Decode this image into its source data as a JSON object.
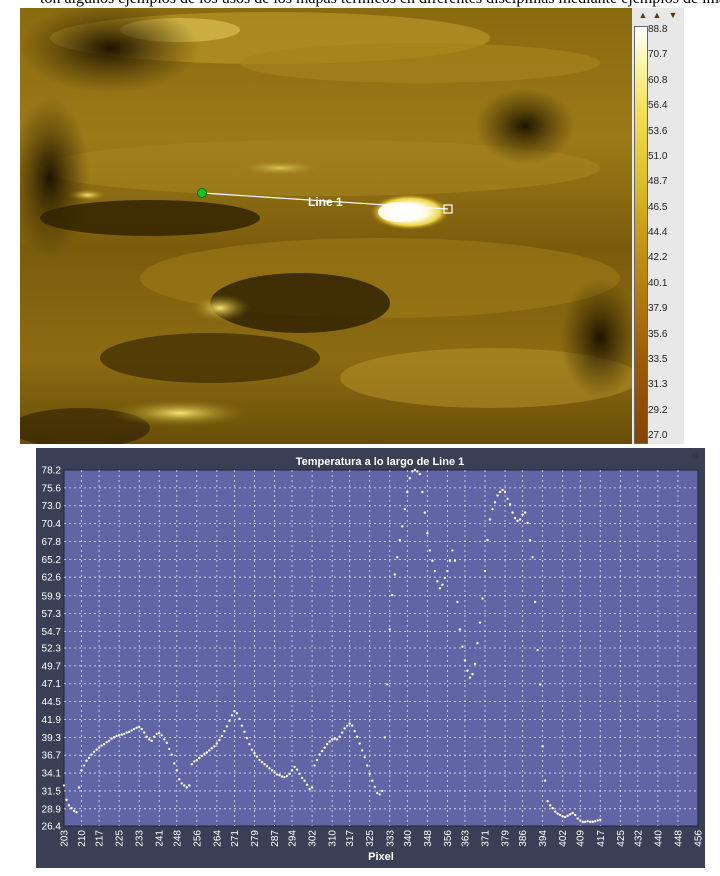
{
  "top_text": "ton algunos ejemplos de los usos de los mapas térmicos en diferentes disciplinas mediante ejemplos de imágenes",
  "thermal_image": {
    "line_label": "Line 1"
  },
  "color_scale": {
    "ticks": [
      "88.8",
      "70.7",
      "60.8",
      "56.4",
      "53.6",
      "51.0",
      "48.7",
      "46.5",
      "44.4",
      "42.2",
      "40.1",
      "37.9",
      "35.6",
      "33.5",
      "31.3",
      "29.2",
      "27.0"
    ],
    "colors": {
      "hot": "#ffffff",
      "mid": "#c89a18",
      "cold": "#844404"
    }
  },
  "collapse_icon_text": "«",
  "chart_data": {
    "type": "scatter",
    "title": "Temperatura a lo largo de Line 1",
    "xlabel": "Pixel",
    "ylabel": "",
    "xlim": [
      203,
      456
    ],
    "ylim": [
      26.4,
      78.2
    ],
    "grid": true,
    "xticks": [
      203,
      210,
      217,
      225,
      233,
      241,
      248,
      256,
      264,
      271,
      279,
      287,
      294,
      302,
      310,
      317,
      325,
      333,
      340,
      348,
      356,
      363,
      371,
      379,
      386,
      394,
      402,
      409,
      417,
      425,
      432,
      440,
      448,
      456
    ],
    "yticks": [
      26.4,
      28.9,
      31.5,
      34.1,
      36.7,
      39.3,
      41.9,
      44.5,
      47.1,
      49.7,
      52.3,
      54.7,
      57.3,
      59.9,
      62.6,
      65.2,
      67.8,
      70.4,
      73.0,
      75.6,
      78.2
    ],
    "points": [
      [
        203,
        32.3
      ],
      [
        204,
        30.2
      ],
      [
        205,
        29.4
      ],
      [
        206,
        29.0
      ],
      [
        207,
        28.6
      ],
      [
        208,
        28.4
      ],
      [
        209,
        32.0
      ],
      [
        210,
        34.5
      ],
      [
        211,
        35.2
      ],
      [
        212,
        35.9
      ],
      [
        213,
        36.3
      ],
      [
        214,
        36.8
      ],
      [
        215,
        37.2
      ],
      [
        216,
        37.5
      ],
      [
        217,
        37.8
      ],
      [
        218,
        38.1
      ],
      [
        219,
        38.3
      ],
      [
        220,
        38.6
      ],
      [
        221,
        38.8
      ],
      [
        222,
        39.1
      ],
      [
        223,
        39.3
      ],
      [
        224,
        39.5
      ],
      [
        225,
        39.6
      ],
      [
        226,
        39.7
      ],
      [
        227,
        39.8
      ],
      [
        228,
        40.0
      ],
      [
        229,
        40.1
      ],
      [
        230,
        40.3
      ],
      [
        231,
        40.5
      ],
      [
        232,
        40.7
      ],
      [
        233,
        40.8
      ],
      [
        234,
        40.5
      ],
      [
        235,
        40.0
      ],
      [
        236,
        39.4
      ],
      [
        237,
        39.0
      ],
      [
        238,
        38.8
      ],
      [
        239,
        39.4
      ],
      [
        240,
        39.8
      ],
      [
        241,
        39.9
      ],
      [
        242,
        39.6
      ],
      [
        243,
        39.0
      ],
      [
        244,
        38.5
      ],
      [
        245,
        37.6
      ],
      [
        246,
        36.8
      ],
      [
        247,
        35.5
      ],
      [
        248,
        34.5
      ],
      [
        249,
        33.2
      ],
      [
        250,
        32.6
      ],
      [
        251,
        32.3
      ],
      [
        252,
        32.0
      ],
      [
        253,
        32.3
      ],
      [
        254,
        35.4
      ],
      [
        255,
        35.8
      ],
      [
        256,
        36.0
      ],
      [
        257,
        36.3
      ],
      [
        258,
        36.6
      ],
      [
        259,
        36.9
      ],
      [
        260,
        37.1
      ],
      [
        261,
        37.4
      ],
      [
        262,
        37.7
      ],
      [
        263,
        38.0
      ],
      [
        264,
        38.4
      ],
      [
        265,
        38.9
      ],
      [
        266,
        39.5
      ],
      [
        267,
        40.2
      ],
      [
        268,
        40.9
      ],
      [
        269,
        41.7
      ],
      [
        270,
        42.5
      ],
      [
        271,
        43.1
      ],
      [
        272,
        42.8
      ],
      [
        273,
        42.0
      ],
      [
        274,
        41.0
      ],
      [
        275,
        40.1
      ],
      [
        276,
        39.2
      ],
      [
        277,
        38.3
      ],
      [
        278,
        37.5
      ],
      [
        279,
        37.0
      ],
      [
        280,
        36.5
      ],
      [
        281,
        36.0
      ],
      [
        282,
        35.7
      ],
      [
        283,
        35.4
      ],
      [
        284,
        35.1
      ],
      [
        285,
        34.8
      ],
      [
        286,
        34.5
      ],
      [
        287,
        34.2
      ],
      [
        288,
        33.9
      ],
      [
        289,
        33.8
      ],
      [
        290,
        33.6
      ],
      [
        291,
        33.5
      ],
      [
        292,
        33.7
      ],
      [
        293,
        34.0
      ],
      [
        294,
        34.5
      ],
      [
        295,
        35.0
      ],
      [
        296,
        34.6
      ],
      [
        297,
        34.0
      ],
      [
        298,
        33.4
      ],
      [
        299,
        33.0
      ],
      [
        300,
        32.4
      ],
      [
        301,
        31.8
      ],
      [
        302,
        32.0
      ],
      [
        303,
        35.2
      ],
      [
        304,
        36.0
      ],
      [
        305,
        36.8
      ],
      [
        306,
        37.3
      ],
      [
        307,
        37.8
      ],
      [
        308,
        38.3
      ],
      [
        309,
        38.7
      ],
      [
        310,
        39.0
      ],
      [
        311,
        39.1
      ],
      [
        312,
        39.0
      ],
      [
        313,
        39.4
      ],
      [
        314,
        40.0
      ],
      [
        315,
        40.6
      ],
      [
        316,
        41.0
      ],
      [
        317,
        41.3
      ],
      [
        318,
        41.0
      ],
      [
        319,
        40.2
      ],
      [
        320,
        39.4
      ],
      [
        321,
        38.4
      ],
      [
        322,
        37.4
      ],
      [
        323,
        36.4
      ],
      [
        324,
        35.2
      ],
      [
        325,
        34.0
      ],
      [
        326,
        33.0
      ],
      [
        327,
        32.1
      ],
      [
        328,
        31.2
      ],
      [
        329,
        31.0
      ],
      [
        330,
        31.5
      ],
      [
        331,
        39.3
      ],
      [
        332,
        47.0
      ],
      [
        333,
        55.0
      ],
      [
        334,
        60.0
      ],
      [
        335,
        63.0
      ],
      [
        336,
        65.5
      ],
      [
        337,
        68.0
      ],
      [
        338,
        70.0
      ],
      [
        339,
        72.5
      ],
      [
        340,
        75.0
      ],
      [
        341,
        77.0
      ],
      [
        342,
        78.0
      ],
      [
        343,
        78.2
      ],
      [
        344,
        78.0
      ],
      [
        345,
        77.6
      ],
      [
        346,
        75.0
      ],
      [
        347,
        72.0
      ],
      [
        348,
        69.0
      ],
      [
        349,
        66.5
      ],
      [
        350,
        65.0
      ],
      [
        351,
        63.5
      ],
      [
        352,
        62.0
      ],
      [
        353,
        61.0
      ],
      [
        354,
        61.5
      ],
      [
        355,
        62.5
      ],
      [
        356,
        63.5
      ],
      [
        357,
        65.0
      ],
      [
        358,
        66.5
      ],
      [
        359,
        65.0
      ],
      [
        360,
        59.0
      ],
      [
        361,
        55.0
      ],
      [
        362,
        52.5
      ],
      [
        363,
        50.5
      ],
      [
        364,
        49.0
      ],
      [
        365,
        48.0
      ],
      [
        366,
        48.5
      ],
      [
        367,
        50.0
      ],
      [
        368,
        53.0
      ],
      [
        369,
        56.0
      ],
      [
        370,
        59.5
      ],
      [
        371,
        63.5
      ],
      [
        372,
        68.0
      ],
      [
        373,
        71.0
      ],
      [
        374,
        72.5
      ],
      [
        375,
        73.5
      ],
      [
        376,
        74.5
      ],
      [
        377,
        75.0
      ],
      [
        378,
        75.3
      ],
      [
        379,
        75.0
      ],
      [
        380,
        74.0
      ],
      [
        381,
        73.2
      ],
      [
        382,
        72.0
      ],
      [
        383,
        71.2
      ],
      [
        384,
        70.8
      ],
      [
        385,
        71.0
      ],
      [
        386,
        71.7
      ],
      [
        387,
        72.0
      ],
      [
        388,
        70.5
      ],
      [
        389,
        68.0
      ],
      [
        390,
        65.5
      ],
      [
        391,
        59.0
      ],
      [
        392,
        52.0
      ],
      [
        393,
        47.0
      ],
      [
        394,
        38.0
      ],
      [
        395,
        33.0
      ],
      [
        396,
        30.0
      ],
      [
        397,
        29.4
      ],
      [
        398,
        29.0
      ],
      [
        399,
        28.5
      ],
      [
        400,
        28.2
      ],
      [
        401,
        28.0
      ],
      [
        402,
        27.8
      ],
      [
        403,
        27.7
      ],
      [
        404,
        27.9
      ],
      [
        405,
        28.1
      ],
      [
        406,
        28.3
      ],
      [
        407,
        28.0
      ],
      [
        408,
        27.5
      ],
      [
        409,
        27.2
      ],
      [
        410,
        27.0
      ],
      [
        411,
        27.0
      ],
      [
        412,
        27.1
      ],
      [
        413,
        27.0
      ],
      [
        414,
        27.0
      ],
      [
        415,
        27.1
      ],
      [
        416,
        27.2
      ],
      [
        417,
        27.3
      ]
    ]
  }
}
